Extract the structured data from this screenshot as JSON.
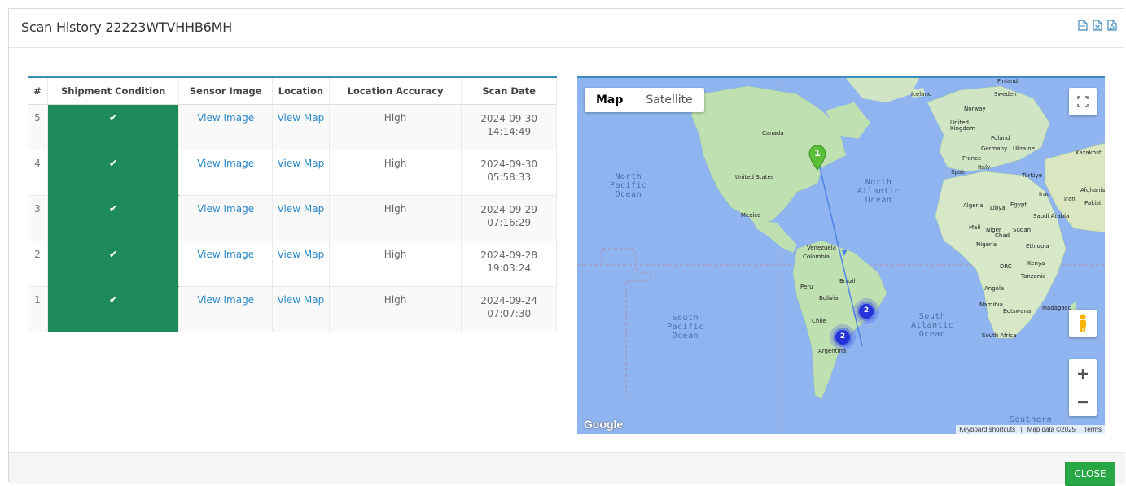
{
  "title": "Scan History 22223WTVHHB6MH",
  "exports": [
    {
      "icon": "file-text-icon",
      "color": "#3c8dbc"
    },
    {
      "icon": "file-excel-icon",
      "color": "#3c8dbc"
    },
    {
      "icon": "file-pdf-icon",
      "color": "#3c8dbc"
    }
  ],
  "table": {
    "headers": [
      "#",
      "Shipment Condition",
      "Sensor Image",
      "Location",
      "Location Accuracy",
      "Scan Date"
    ],
    "rows": [
      {
        "num": "5",
        "condition": "✔",
        "image": "View Image",
        "location": "View Map",
        "accuracy": "High",
        "date": "2024-09-30",
        "time": "14:14:49"
      },
      {
        "num": "4",
        "condition": "✔",
        "image": "View Image",
        "location": "View Map",
        "accuracy": "High",
        "date": "2024-09-30",
        "time": "05:58:33"
      },
      {
        "num": "3",
        "condition": "✔",
        "image": "View Image",
        "location": "View Map",
        "accuracy": "High",
        "date": "2024-09-29",
        "time": "07:16:29"
      },
      {
        "num": "2",
        "condition": "✔",
        "image": "View Image",
        "location": "View Map",
        "accuracy": "High",
        "date": "2024-09-28",
        "time": "19:03:24"
      },
      {
        "num": "1",
        "condition": "✔",
        "image": "View Image",
        "location": "View Map",
        "accuracy": "High",
        "date": "2024-09-24",
        "time": "07:07:30"
      }
    ],
    "condition_color": "#1f8a5a"
  },
  "map": {
    "type_buttons": [
      "Map",
      "Satellite"
    ],
    "active_type": "Map",
    "marker_label": "1",
    "cluster_labels": [
      "2",
      "2"
    ],
    "oceans": {
      "north_pacific": [
        "North",
        "Pacific",
        "Ocean"
      ],
      "north_atlantic": [
        "North",
        "Atlantic",
        "Ocean"
      ],
      "south_pacific": [
        "South",
        "Pacific",
        "Ocean"
      ],
      "south_atlantic": [
        "South",
        "Atlantic",
        "Ocean"
      ],
      "southern": "Southern"
    },
    "places": {
      "canada": "Canada",
      "us": "United States",
      "mexico": "Mexico",
      "venezuela": "Venezuela",
      "colombia": "Colombia",
      "brazil": "Brazil",
      "peru": "Peru",
      "bolivia": "Bolivia",
      "chile": "Chile",
      "argentina": "Argentina",
      "iceland": "Iceland",
      "sweden": "Sweden",
      "norway": "Norway",
      "uk": "United Kingdom",
      "poland": "Poland",
      "germany": "Germany",
      "ukraine": "Ukraine",
      "france": "France",
      "italy": "Italy",
      "spain": "Spain",
      "turkiye": "Türkiye",
      "kazakhstan": "Kazakhst",
      "iraq": "Iraq",
      "iran": "Iran",
      "afghanistan": "Afghanis",
      "pakistan": "Pakist",
      "algeria": "Algeria",
      "libya": "Libya",
      "egypt": "Egypt",
      "saudi": "Saudi Arabia",
      "mali": "Mali",
      "niger": "Niger",
      "chad": "Chad",
      "sudan": "Sudan",
      "nigeria": "Nigeria",
      "ethiopia": "Ethiopia",
      "drc": "DRC",
      "kenya": "Kenya",
      "tanzania": "Tanzania",
      "angola": "Angola",
      "namibia": "Namibia",
      "botswana": "Botswana",
      "madagascar": "Madagasc",
      "south_africa": "South Africa",
      "finland": "Finland"
    },
    "google": "Google",
    "attribution": [
      "Keyboard shortcuts",
      "Map data ©2025",
      "Terms"
    ],
    "water_color": "#8fb4f0",
    "land_color": "#bfe0b0"
  },
  "footer": {
    "close_label": "CLOSE",
    "close_color": "#28a745"
  }
}
